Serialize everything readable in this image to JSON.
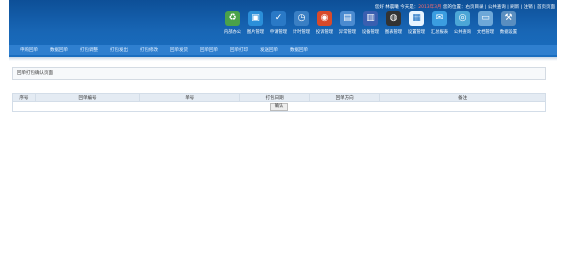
{
  "header": {
    "user_text": "您好 林晨曦  今天是：",
    "date_text": "2013年3月",
    "links_text": "您的位置：右页目录 | 公共查询 | 刷新 | 注销 | 首页页面"
  },
  "toolbar": [
    {
      "label": "内部办公",
      "icon": "recycle-people-icon",
      "color": "#4aa24a",
      "glyph": "♻"
    },
    {
      "label": "图片管理",
      "icon": "picture-icon",
      "color": "#2b8fd9",
      "glyph": "▣"
    },
    {
      "label": "申请管理",
      "icon": "tick-circle-icon",
      "color": "#2a79c6",
      "glyph": "✓"
    },
    {
      "label": "计时管理",
      "icon": "clock-icon",
      "color": "#3a7fc4",
      "glyph": "◷"
    },
    {
      "label": "投诉管理",
      "icon": "bell-icon",
      "color": "#d84a2b",
      "glyph": "◉"
    },
    {
      "label": "异常管理",
      "icon": "document-icon",
      "color": "#4b8bd0",
      "glyph": "▤"
    },
    {
      "label": "设备管理",
      "icon": "book-icon",
      "color": "#3a5fb0",
      "glyph": "▥"
    },
    {
      "label": "图表管理",
      "icon": "gauge-icon",
      "color": "#333333",
      "glyph": "◍"
    },
    {
      "label": "设置管理",
      "icon": "card-icon",
      "color": "#e8f4ff",
      "glyph": "▦"
    },
    {
      "label": "汇总报表",
      "icon": "envelope-icon",
      "color": "#3b9de0",
      "glyph": "✉"
    },
    {
      "label": "公共查询",
      "icon": "globe-icon",
      "color": "#4ca6d6",
      "glyph": "◎"
    },
    {
      "label": "文档管理",
      "icon": "folder-icon",
      "color": "#6ea8d8",
      "glyph": "▭"
    },
    {
      "label": "数据设置",
      "icon": "wrench-icon",
      "color": "#5a8ec0",
      "glyph": "⚒"
    }
  ],
  "nav": [
    "申购回单",
    "数据回单",
    "打包调整",
    "打包发出",
    "打包修改",
    "回单发货",
    "回单回单",
    "回单打印",
    "发送回单",
    "数据回单"
  ],
  "crumb": "回单打包确认页面",
  "table": {
    "headers": [
      "序号",
      "回单编号",
      "单号",
      "打包日期",
      "回单方向",
      "备注"
    ],
    "button_label": "确认"
  }
}
